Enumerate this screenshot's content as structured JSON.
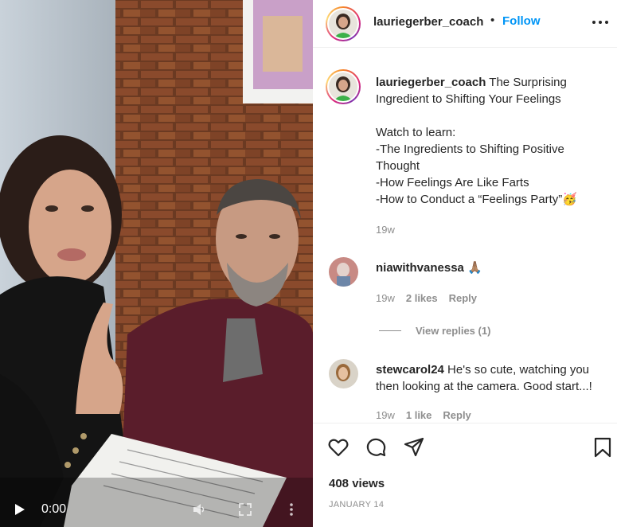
{
  "video": {
    "time": "0:00",
    "icons": [
      "play-icon",
      "volume-icon",
      "fullscreen-icon",
      "more-icon"
    ]
  },
  "header": {
    "username": "lauriegerber_coach",
    "dot": "•",
    "follow_label": "Follow",
    "more_icon": "more-horizontal-icon"
  },
  "caption": {
    "username": "lauriegerber_coach",
    "text": " The Surprising Ingredient to Shifting Your Feelings\n\nWatch to learn:\n-The Ingredients to Shifting Positive Thought\n-How Feelings Are Like Farts\n-How to Conduct a “Feelings Party”🥳",
    "time": "19w"
  },
  "comments": [
    {
      "username": "niawithvanessa",
      "text": " 🙏🏽",
      "time": "19w",
      "likes": "2 likes",
      "reply_label": "Reply",
      "view_replies": "View replies (1)"
    },
    {
      "username": "stewcarol24",
      "text": " He's so cute, watching you then looking at the camera. Good start...!",
      "time": "19w",
      "likes": "1 like",
      "reply_label": "Reply"
    }
  ],
  "actions": {
    "icons": [
      "heart-icon",
      "comment-icon",
      "share-icon",
      "bookmark-icon"
    ],
    "views": "408 views",
    "date": "JANUARY 14"
  },
  "colors": {
    "accent": "#0095f6",
    "text": "#262626",
    "muted": "#8e8e8e",
    "border": "#efefef"
  }
}
